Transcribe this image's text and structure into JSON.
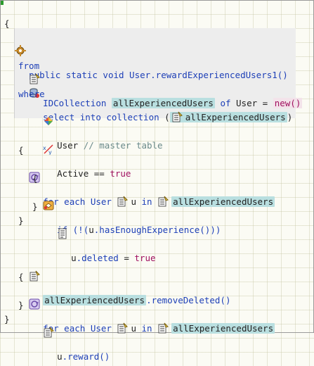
{
  "header": {
    "signature": "public static void User.rewardExperiencedUsers1()"
  },
  "code": {
    "open_brace": "{",
    "close_brace": "}",
    "decl_type": "IDCollection",
    "collection_name": "allExperiencedUsers",
    "of_kw": "of",
    "user_type": "User",
    "assign_op": "=",
    "new_call": "new()",
    "select_kw": "select into collection",
    "paren_open": "(",
    "paren_close": ")",
    "from_kw": "from",
    "comment": "// master table",
    "where_kw": "where",
    "active_field": "Active",
    "eq_op": "==",
    "true_val": "true",
    "for_each_kw": "for each",
    "loop_var": "u",
    "in_kw": "in",
    "if_kw": "if",
    "if_cond_pre": "(!(",
    "if_cond_var": "u",
    "if_cond_method": ".hasEnoughExperience",
    "if_cond_post": "()))",
    "deleted_stmt": "u.deleted",
    "remove_call": ".removeDeleted()",
    "reward_obj": "u",
    "reward_method": ".reward()"
  },
  "colors": {
    "keyword": "#1d3fb7",
    "highlight": "#b9dfe0",
    "literal": "#a01060",
    "comment": "#6a8a8a"
  },
  "icons": [
    "method-gear-icon",
    "variable-declaration-icon",
    "select-database-icon",
    "table-icon",
    "filter-xy-icon",
    "loop-icon",
    "if-icon",
    "statement-icon",
    "method-call-icon"
  ]
}
